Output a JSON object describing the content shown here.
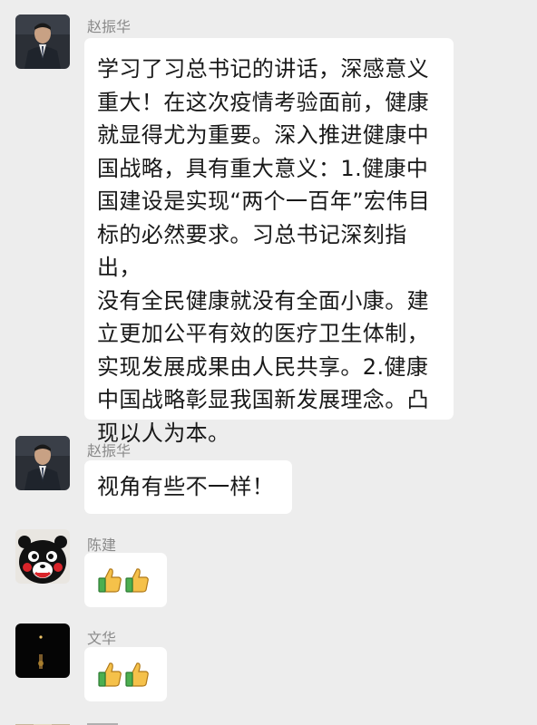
{
  "messages": [
    {
      "sender": "赵振华",
      "avatar": "man-in-suit-photo",
      "type": "text",
      "text": "学习了习总书记的讲话，深感意义\n重大！在这次疫情考验面前，健康\n就显得尤为重要。深入推进健康中\n国战略，具有重大意义：1.健康中\n国建设是实现“两个一百年”宏伟目\n标的必然要求。习总书记深刻指出，\n没有全民健康就没有全面小康。建\n立更加公平有效的医疗卫生体制，\n实现发展成果由人民共享。2.健康\n中国战略彰显我国新发展理念。凸\n现以人为本。"
    },
    {
      "sender": "赵振华",
      "avatar": "man-in-suit-photo",
      "type": "text",
      "text": "视角有些不一样！"
    },
    {
      "sender": "陈建",
      "avatar": "kumamon-bear-avatar",
      "type": "emoji",
      "emojis": [
        "thumbs-up-icon",
        "thumbs-up-icon"
      ]
    },
    {
      "sender": "文华",
      "avatar": "dark-night-photo",
      "type": "emoji",
      "emojis": [
        "thumbs-up-icon",
        "thumbs-up-icon"
      ]
    },
    {
      "sender": "",
      "avatar": "partial-avatar",
      "type": "partial"
    }
  ],
  "colors": {
    "background": "#ededed",
    "bubble": "#ffffff",
    "sender_name": "#8a8a8a",
    "text": "#191919"
  }
}
